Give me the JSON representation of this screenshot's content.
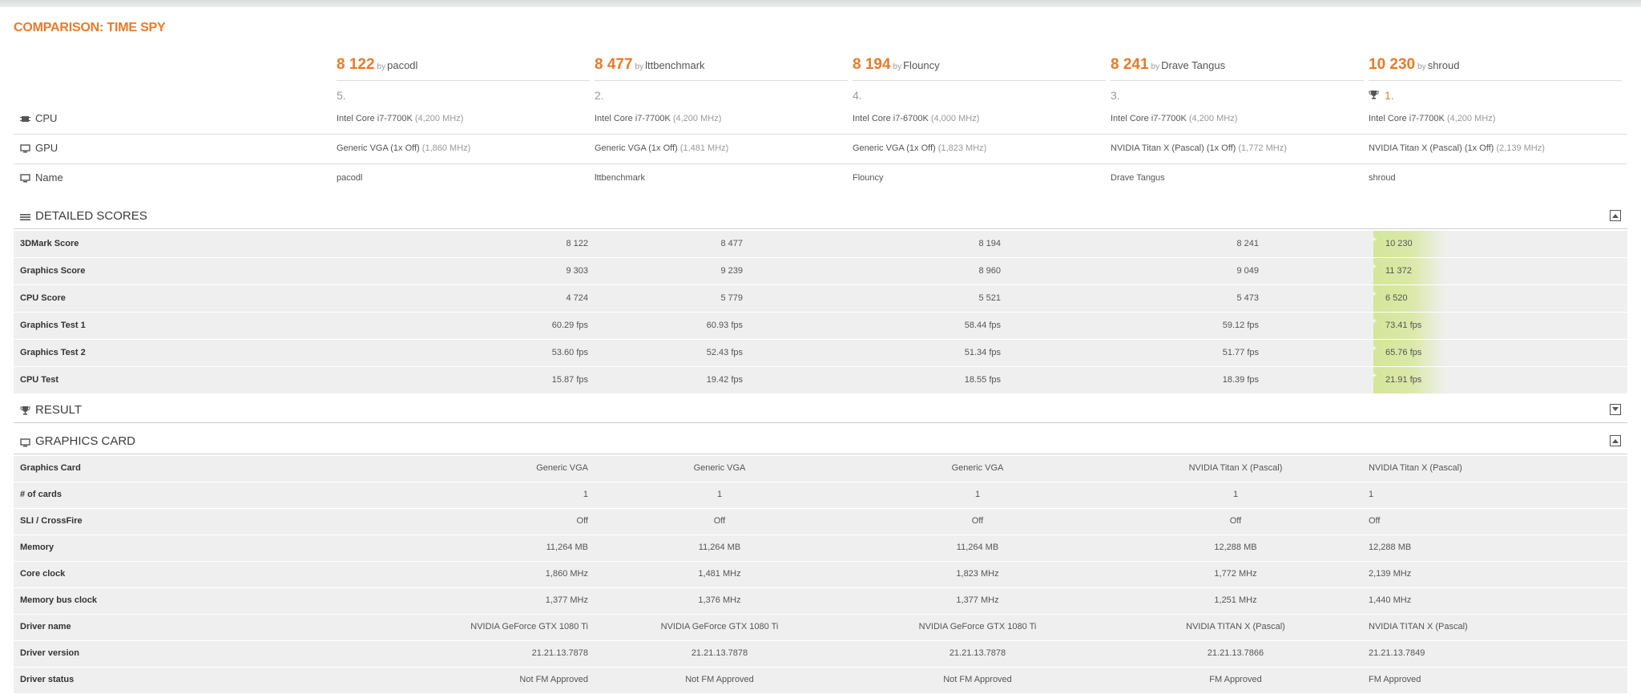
{
  "page_title": "COMPARISON: TIME SPY",
  "by_text": "by",
  "results": [
    {
      "score": "8 122",
      "user": "pacodl",
      "rank": "5.",
      "first": false
    },
    {
      "score": "8 477",
      "user": "lttbenchmark",
      "rank": "2.",
      "first": false
    },
    {
      "score": "8 194",
      "user": "Flouncy",
      "rank": "4.",
      "first": false
    },
    {
      "score": "8 241",
      "user": "Drave Tangus",
      "rank": "3.",
      "first": false
    },
    {
      "score": "10 230",
      "user": "shroud",
      "rank": "1.",
      "first": true
    }
  ],
  "system": {
    "cpu_label": "CPU",
    "gpu_label": "GPU",
    "name_label": "Name",
    "cpu": [
      {
        "name": "Intel Core i7-7700K",
        "clock": "(4,200 MHz)"
      },
      {
        "name": "Intel Core i7-7700K",
        "clock": "(4,200 MHz)"
      },
      {
        "name": "Intel Core i7-6700K",
        "clock": "(4,000 MHz)"
      },
      {
        "name": "Intel Core i7-7700K",
        "clock": "(4,200 MHz)"
      },
      {
        "name": "Intel Core i7-7700K",
        "clock": "(4,200 MHz)"
      }
    ],
    "gpu": [
      {
        "name": "Generic VGA (1x Off)",
        "clock": "(1,860 MHz)"
      },
      {
        "name": "Generic VGA (1x Off)",
        "clock": "(1,481 MHz)"
      },
      {
        "name": "Generic VGA (1x Off)",
        "clock": "(1,823 MHz)"
      },
      {
        "name": "NVIDIA Titan X (Pascal) (1x Off)",
        "clock": "(1,772 MHz)"
      },
      {
        "name": "NVIDIA Titan X (Pascal) (1x Off)",
        "clock": "(2,139 MHz)"
      }
    ],
    "names": [
      "pacodl",
      "lttbenchmark",
      "Flouncy",
      "Drave Tangus",
      "shroud"
    ]
  },
  "detailed": {
    "title": "DETAILED SCORES",
    "rows": [
      {
        "label": "3DMark Score",
        "values": [
          "8 122",
          "8 477",
          "8 194",
          "8 241",
          "10 230"
        ]
      },
      {
        "label": "Graphics Score",
        "values": [
          "9 303",
          "9 239",
          "8 960",
          "9 049",
          "11 372"
        ]
      },
      {
        "label": "CPU Score",
        "values": [
          "4 724",
          "5 779",
          "5 521",
          "5 473",
          "6 520"
        ]
      },
      {
        "label": "Graphics Test 1",
        "values": [
          "60.29 fps",
          "60.93 fps",
          "58.44 fps",
          "59.12 fps",
          "73.41 fps"
        ]
      },
      {
        "label": "Graphics Test 2",
        "values": [
          "53.60 fps",
          "52.43 fps",
          "51.34 fps",
          "51.77 fps",
          "65.76 fps"
        ]
      },
      {
        "label": "CPU Test",
        "values": [
          "15.87 fps",
          "19.42 fps",
          "18.55 fps",
          "18.39 fps",
          "21.91 fps"
        ]
      }
    ]
  },
  "result_section": {
    "title": "RESULT"
  },
  "graphics": {
    "title": "GRAPHICS CARD",
    "rows": [
      {
        "label": "Graphics Card",
        "values": [
          "Generic VGA",
          "Generic VGA",
          "Generic VGA",
          "NVIDIA Titan X (Pascal)",
          "NVIDIA Titan X (Pascal)"
        ]
      },
      {
        "label": "# of cards",
        "values": [
          "1",
          "1",
          "1",
          "1",
          "1"
        ]
      },
      {
        "label": "SLI / CrossFire",
        "values": [
          "Off",
          "Off",
          "Off",
          "Off",
          "Off"
        ]
      },
      {
        "label": "Memory",
        "values": [
          "11,264 MB",
          "11,264 MB",
          "11,264 MB",
          "12,288 MB",
          "12,288 MB"
        ]
      },
      {
        "label": "Core clock",
        "values": [
          "1,860 MHz",
          "1,481 MHz",
          "1,823 MHz",
          "1,772 MHz",
          "2,139 MHz"
        ]
      },
      {
        "label": "Memory bus clock",
        "values": [
          "1,377 MHz",
          "1,376 MHz",
          "1,377 MHz",
          "1,251 MHz",
          "1,440 MHz"
        ]
      },
      {
        "label": "Driver name",
        "values": [
          "NVIDIA GeForce GTX 1080 Ti",
          "NVIDIA GeForce GTX 1080 Ti",
          "NVIDIA GeForce GTX 1080 Ti",
          "NVIDIA TITAN X (Pascal)",
          "NVIDIA TITAN X (Pascal)"
        ]
      },
      {
        "label": "Driver version",
        "values": [
          "21.21.13.7878",
          "21.21.13.7878",
          "21.21.13.7878",
          "21.21.13.7866",
          "21.21.13.7849"
        ]
      },
      {
        "label": "Driver status",
        "values": [
          "Not FM Approved",
          "Not FM Approved",
          "Not FM Approved",
          "FM Approved",
          "FM Approved"
        ]
      }
    ]
  },
  "colors": {
    "accent": "#e97a2a",
    "highlight": "#d4e69a",
    "row_bg": "#efefef"
  },
  "icons": {
    "cpu": "cpu-chip-icon",
    "gpu": "monitor-icon",
    "name": "monitor-icon",
    "detailed": "list-icon",
    "result": "trophy-icon",
    "graphics": "monitor-icon",
    "collapse": "collapse-toggle-icon"
  }
}
